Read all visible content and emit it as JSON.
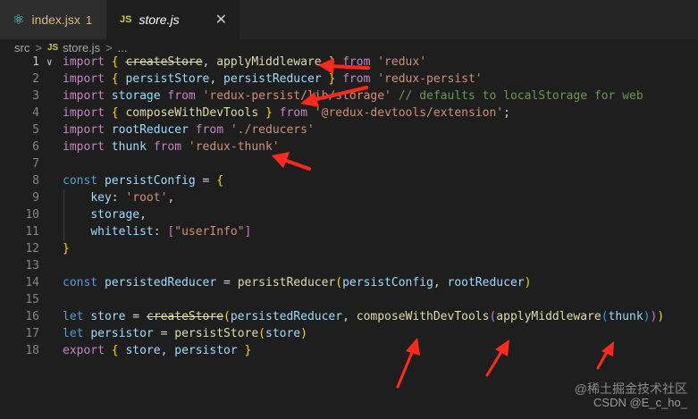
{
  "tabs": [
    {
      "label": "index.jsx",
      "badge": "1",
      "icon": "react-icon"
    },
    {
      "label": "store.js",
      "icon": "js-badge",
      "icon_text": "JS"
    }
  ],
  "breadcrumb": {
    "folder": "src",
    "file_badge": "JS",
    "file": "store.js",
    "sep": ">",
    "more": "..."
  },
  "code_lines": [
    {
      "n": "1",
      "tokens": [
        [
          "kw",
          "import"
        ],
        [
          "pn",
          " "
        ],
        [
          "b1",
          "{"
        ],
        [
          "pn",
          " "
        ],
        [
          "fn strike",
          "createStore"
        ],
        [
          "pn",
          ", "
        ],
        [
          "fn",
          "applyMiddleware"
        ],
        [
          "pn",
          " "
        ],
        [
          "b1",
          "}"
        ],
        [
          "pn",
          " "
        ],
        [
          "kw",
          "from"
        ],
        [
          "pn",
          " "
        ],
        [
          "str",
          "'redux'"
        ]
      ]
    },
    {
      "n": "2",
      "tokens": [
        [
          "kw",
          "import"
        ],
        [
          "pn",
          " "
        ],
        [
          "b1",
          "{"
        ],
        [
          "pn",
          " "
        ],
        [
          "var",
          "persistStore"
        ],
        [
          "pn",
          ", "
        ],
        [
          "var",
          "persistReducer"
        ],
        [
          "pn",
          " "
        ],
        [
          "b1",
          "}"
        ],
        [
          "pn",
          " "
        ],
        [
          "kw",
          "from"
        ],
        [
          "pn",
          " "
        ],
        [
          "str",
          "'redux-persist'"
        ]
      ]
    },
    {
      "n": "3",
      "tokens": [
        [
          "kw",
          "import"
        ],
        [
          "pn",
          " "
        ],
        [
          "var",
          "storage"
        ],
        [
          "pn",
          " "
        ],
        [
          "kw",
          "from"
        ],
        [
          "pn",
          " "
        ],
        [
          "str",
          "'redux-persist/lib/storage'"
        ],
        [
          "pn",
          " "
        ],
        [
          "cm",
          "// defaults to localStorage for web"
        ]
      ]
    },
    {
      "n": "4",
      "tokens": [
        [
          "kw",
          "import"
        ],
        [
          "pn",
          " "
        ],
        [
          "b1",
          "{"
        ],
        [
          "pn",
          " "
        ],
        [
          "fn",
          "composeWithDevTools"
        ],
        [
          "pn",
          " "
        ],
        [
          "b1",
          "}"
        ],
        [
          "pn",
          " "
        ],
        [
          "kw",
          "from"
        ],
        [
          "pn",
          " "
        ],
        [
          "str",
          "'@redux-devtools/extension'"
        ],
        [
          "pn",
          ";"
        ]
      ]
    },
    {
      "n": "5",
      "tokens": [
        [
          "kw",
          "import"
        ],
        [
          "pn",
          " "
        ],
        [
          "var",
          "rootReducer"
        ],
        [
          "pn",
          " "
        ],
        [
          "kw",
          "from"
        ],
        [
          "pn",
          " "
        ],
        [
          "str",
          "'./reducers'"
        ]
      ]
    },
    {
      "n": "6",
      "tokens": [
        [
          "kw",
          "import"
        ],
        [
          "pn",
          " "
        ],
        [
          "var",
          "thunk"
        ],
        [
          "pn",
          " "
        ],
        [
          "kw",
          "from"
        ],
        [
          "pn",
          " "
        ],
        [
          "str",
          "'redux-thunk'"
        ]
      ]
    },
    {
      "n": "7",
      "tokens": []
    },
    {
      "n": "8",
      "tokens": [
        [
          "st",
          "const"
        ],
        [
          "pn",
          " "
        ],
        [
          "var",
          "persistConfig"
        ],
        [
          "pn",
          " = "
        ],
        [
          "b1",
          "{"
        ]
      ]
    },
    {
      "n": "9",
      "tokens": [
        [
          "pn",
          "    "
        ],
        [
          "var",
          "key"
        ],
        [
          "pn",
          ": "
        ],
        [
          "str",
          "'root'"
        ],
        [
          "pn",
          ","
        ]
      ]
    },
    {
      "n": "10",
      "tokens": [
        [
          "pn",
          "    "
        ],
        [
          "var",
          "storage"
        ],
        [
          "pn",
          ","
        ]
      ]
    },
    {
      "n": "11",
      "tokens": [
        [
          "pn",
          "    "
        ],
        [
          "var",
          "whitelist"
        ],
        [
          "pn",
          ": "
        ],
        [
          "b2",
          "["
        ],
        [
          "str",
          "\"userInfo\""
        ],
        [
          "b2",
          "]"
        ]
      ]
    },
    {
      "n": "12",
      "tokens": [
        [
          "b1",
          "}"
        ]
      ]
    },
    {
      "n": "13",
      "tokens": []
    },
    {
      "n": "14",
      "tokens": [
        [
          "st",
          "const"
        ],
        [
          "pn",
          " "
        ],
        [
          "var",
          "persistedReducer"
        ],
        [
          "pn",
          " = "
        ],
        [
          "fn",
          "persistReducer"
        ],
        [
          "b1",
          "("
        ],
        [
          "var",
          "persistConfig"
        ],
        [
          "pn",
          ", "
        ],
        [
          "var",
          "rootReducer"
        ],
        [
          "b1",
          ")"
        ]
      ]
    },
    {
      "n": "15",
      "tokens": []
    },
    {
      "n": "16",
      "tokens": [
        [
          "st",
          "let"
        ],
        [
          "pn",
          " "
        ],
        [
          "var",
          "store"
        ],
        [
          "pn",
          " = "
        ],
        [
          "fn strike",
          "createStore"
        ],
        [
          "b1",
          "("
        ],
        [
          "var",
          "persistedReducer"
        ],
        [
          "pn",
          ", "
        ],
        [
          "fn",
          "composeWithDevTools"
        ],
        [
          "b2",
          "("
        ],
        [
          "fn",
          "applyMiddleware"
        ],
        [
          "b3",
          "("
        ],
        [
          "var",
          "thunk"
        ],
        [
          "b3",
          ")"
        ],
        [
          "b2",
          ")"
        ],
        [
          "b1",
          ")"
        ]
      ]
    },
    {
      "n": "17",
      "tokens": [
        [
          "st",
          "let"
        ],
        [
          "pn",
          " "
        ],
        [
          "var",
          "persistor"
        ],
        [
          "pn",
          " = "
        ],
        [
          "fn",
          "persistStore"
        ],
        [
          "b1",
          "("
        ],
        [
          "var",
          "store"
        ],
        [
          "b1",
          ")"
        ]
      ]
    },
    {
      "n": "18",
      "tokens": [
        [
          "kw",
          "export"
        ],
        [
          "pn",
          " "
        ],
        [
          "b1",
          "{"
        ],
        [
          "pn",
          " "
        ],
        [
          "var",
          "store"
        ],
        [
          "pn",
          ", "
        ],
        [
          "var",
          "persistor"
        ],
        [
          "pn",
          " "
        ],
        [
          "b1",
          "}"
        ]
      ]
    }
  ],
  "watermark": {
    "line1": "@稀土掘金技术社区",
    "line2": "CSDN @E_c_ho_"
  },
  "colors": {
    "background": "#1e1e1e",
    "tab_bar": "#252526",
    "arrow": "#ff2a1a"
  }
}
